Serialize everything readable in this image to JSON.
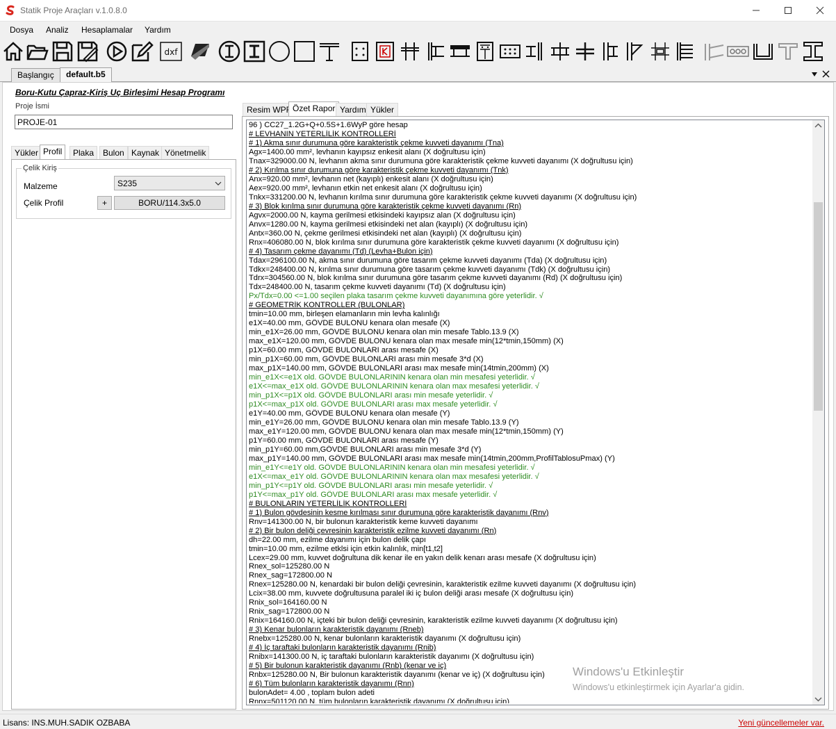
{
  "window": {
    "title": "Statik Proje Araçları v.1.0.8.0"
  },
  "menu": {
    "items": [
      "Dosya",
      "Analiz",
      "Hesaplamalar",
      "Yardım"
    ]
  },
  "toolbar": {
    "dxf_label": "dxf"
  },
  "doc_tabs": [
    "Başlangıç",
    "default.b5"
  ],
  "left": {
    "program_title": "Boru-Kutu Çapraz-Kiriş Uç Birleşimi Hesap Programı",
    "project_label": "Proje İsmi",
    "project_value": "PROJE-01",
    "tabs": [
      "Yükler",
      "Profil",
      "Plaka",
      "Bulon",
      "Kaynak",
      "Yönetmelik"
    ],
    "group_title": "Çelik Kiriş",
    "material_label": "Malzeme",
    "material_value": "S235",
    "profile_label": "Çelik Profil",
    "add_label": "+",
    "profile_value": "BORU/114.3x5.0"
  },
  "right": {
    "tabs": [
      "Resim WPF",
      "Özet Rapor",
      "Yardım",
      "Yükler"
    ]
  },
  "report_lines": [
    {
      "t": "96 )  CC27_1.2G+Q+0.5S+1.6WyP göre hesap",
      "k": "n"
    },
    {
      "t": "# LEVHANIN YETERLİLİK KONTROLLERİ",
      "k": "h"
    },
    {
      "t": "# 1) Akma sınır durumuna göre karakteristik çekme kuvveti dayanımı (Tna)",
      "k": "h"
    },
    {
      "t": "Agx=1400.00 mm², levhanın kayıpsız enkesit alanı (X doğrultusu için)",
      "k": "n"
    },
    {
      "t": "Tnax=329000.00 N, levhanın akma sınır durumuna göre karakteristik çekme kuvveti dayanımı (X doğrultusu için)",
      "k": "n"
    },
    {
      "t": "# 2) Kırılma sınır durumuna göre karakteristik çekme kuvveti dayanımı (Tnk)",
      "k": "h"
    },
    {
      "t": "Anx=920.00 mm², levhanın net (kayıplı) enkesit alanı (X doğrultusu için)",
      "k": "n"
    },
    {
      "t": "Aex=920.00 mm², levhanın etkin net enkesit alanı (X doğrultusu için)",
      "k": "n"
    },
    {
      "t": "Tnkx=331200.00 N, levhanın kırılma sınır durumuna göre karakteristik çekme kuvveti dayanımı (X doğrultusu için)",
      "k": "n"
    },
    {
      "t": "# 3) Blok kırılma sınır durumuna göre karakteristik çekme kuvveti dayanımı (Rn)",
      "k": "h"
    },
    {
      "t": "Agvx=2000.00 N, kayma gerilmesi etkisindeki kayıpsız alan (X doğrultusu için)",
      "k": "n"
    },
    {
      "t": "Anvx=1280.00 N, kayma gerilmesi etkisindeki net alan (kayıplı) (X doğrultusu için)",
      "k": "n"
    },
    {
      "t": "Antx=360.00 N, çekme gerilmesi etkisindeki net alan (kayıplı) (X doğrultusu için)",
      "k": "n"
    },
    {
      "t": "Rnx=406080.00 N, blok kırılma sınır durumuna göre karakteristik çekme kuvveti dayanımı (X doğrultusu için)",
      "k": "n"
    },
    {
      "t": "# 4) Tasarım çekme dayanımı (Td) (Levha+Bulon için)",
      "k": "h"
    },
    {
      "t": "Tdax=296100.00 N, akma sınır durumuna göre tasarım çekme kuvveti dayanımı (Tda) (X doğrultusu için)",
      "k": "n"
    },
    {
      "t": "Tdkx=248400.00 N, kırılma sınır durumuna göre tasarım çekme kuvveti dayanımı (Tdk) (X doğrultusu için)",
      "k": "n"
    },
    {
      "t": "Tdrx=304560.00 N, blok kırılma sınır durumuna göre tasarım çekme kuvveti dayanımı (Rd) (X doğrultusu için)",
      "k": "n"
    },
    {
      "t": "Tdx=248400.00 N, tasarım çekme kuvveti dayanımı (Td) (X doğrultusu için)",
      "k": "n"
    },
    {
      "t": "Px/Tdx=0.00 <=1.00 seçilen plaka tasarım çekme kuvveti dayanımına göre yeterlidir. √",
      "k": "ok"
    },
    {
      "t": "# GEOMETRİK KONTROLLER (BULONLAR)",
      "k": "h"
    },
    {
      "t": "tmin=10.00 mm, birleşen elamanların min levha kalınlığı",
      "k": "n"
    },
    {
      "t": "e1X=40.00 mm, GÖVDE BULONU kenara olan mesafe (X)",
      "k": "n"
    },
    {
      "t": "min_e1X=26.00 mm, GÖVDE BULONU kenara olan min mesafe Tablo.13.9 (X)",
      "k": "n"
    },
    {
      "t": "max_e1X=120.00 mm, GÖVDE BULONU kenara olan max mesafe min(12*tmin,150mm) (X)",
      "k": "n"
    },
    {
      "t": "p1X=60.00 mm, GÖVDE BULONLARI arası mesafe (X)",
      "k": "n"
    },
    {
      "t": "min_p1X=60.00 mm, GÖVDE BULONLARI arası min mesafe 3*d (X)",
      "k": "n"
    },
    {
      "t": "max_p1X=140.00 mm, GÖVDE BULONLARI arası max mesafe min(14tmin,200mm) (X)",
      "k": "n"
    },
    {
      "t": "min_e1X<=e1X old. GÖVDE BULONLARININ kenara olan min mesafesi yeterlidir. √",
      "k": "ok"
    },
    {
      "t": "e1X<=max_e1X old. GÖVDE BULONLARININ kenara olan max mesafesi yeterlidir. √",
      "k": "ok"
    },
    {
      "t": "min_p1X<=p1X old. GÖVDE BULONLARI arası min mesafe yeterlidir. √",
      "k": "ok"
    },
    {
      "t": "p1X<=max_p1X old. GÖVDE BULONLARI arası max mesafe yeterlidir. √",
      "k": "ok"
    },
    {
      "t": "e1Y=40.00 mm, GÖVDE BULONU kenara olan mesafe (Y)",
      "k": "n"
    },
    {
      "t": "min_e1Y=26.00 mm, GÖVDE BULONU kenara olan min mesafe Tablo.13.9 (Y)",
      "k": "n"
    },
    {
      "t": "max_e1Y=120.00 mm, GÖVDE BULONU kenara olan max mesafe min(12*tmin,150mm) (Y)",
      "k": "n"
    },
    {
      "t": "p1Y=60.00 mm, GÖVDE BULONLARI arası mesafe (Y)",
      "k": "n"
    },
    {
      "t": "min_p1Y=60.00 mm,GÖVDE BULONLARI arası min mesafe 3*d (Y)",
      "k": "n"
    },
    {
      "t": "max_p1Y=140.00 mm, GÖVDE BULONLARI arası max mesafe min(14tmin,200mm,ProfilTablosuPmax) (Y)",
      "k": "n"
    },
    {
      "t": "min_e1Y<=e1Y old. GÖVDE BULONLARININ kenara olan min mesafesi yeterlidir. √",
      "k": "ok"
    },
    {
      "t": "e1X<=max_e1Y old. GÖVDE BULONLARININ kenara olan max mesafesi yeterlidir. √",
      "k": "ok"
    },
    {
      "t": "min_p1Y<=p1Y old. GÖVDE BULONLARI arası min mesafe yeterlidir. √",
      "k": "ok"
    },
    {
      "t": "p1Y<=max_p1Y old. GÖVDE BULONLARI arası max mesafe yeterlidir. √",
      "k": "ok"
    },
    {
      "t": "# BULONLARIN YETERLİLİK KONTROLLERİ",
      "k": "h"
    },
    {
      "t": "# 1) Bulon gövdesinin kesme kırılması sınır durumuna göre karakteristik dayanımı (Rnv)",
      "k": "h"
    },
    {
      "t": "Rnv=141300.00 N, bir bulonun karakteristik keme kuvveti dayanımı",
      "k": "n"
    },
    {
      "t": "# 2) Bir bulon deliği çevresinin karakteristik ezilme kuvveti dayanımı (Rn)",
      "k": "h"
    },
    {
      "t": "dh=22.00 mm, ezilme dayanımı için bulon delik çapı",
      "k": "n"
    },
    {
      "t": "tmin=10.00 mm, ezilme etklsi için etkin kalınlık, min[t1,t2]",
      "k": "n"
    },
    {
      "t": "Lcex=29.00 mm, kuvvet doğrultuna dik kenar ile en yakın delik kenarı arası mesafe (X doğrultusu için)",
      "k": "n"
    },
    {
      "t": "Rnex_sol=125280.00 N",
      "k": "n"
    },
    {
      "t": "Rnex_sag=172800.00 N",
      "k": "n"
    },
    {
      "t": "Rnex=125280.00 N, kenardaki bir bulon deliği çevresinin, karakteristik ezilme kuvveti dayanımı (X doğrultusu için)",
      "k": "n"
    },
    {
      "t": "Lcix=38.00 mm, kuvvete doğrultusuna paralel iki iç bulon deliği arası mesafe (X doğrultusu için)",
      "k": "n"
    },
    {
      "t": "Rnix_sol=164160.00 N",
      "k": "n"
    },
    {
      "t": "Rnix_sag=172800.00 N",
      "k": "n"
    },
    {
      "t": "Rnix=164160.00 N, içteki bir bulon deliği çevresinin, karakteristik ezilme kuvveti dayanımı (X doğrultusu için)",
      "k": "n"
    },
    {
      "t": "# 3) Kenar bulonların karakteristik dayanımı (Rneb)",
      "k": "h"
    },
    {
      "t": "Rnebx=125280.00 N, kenar bulonların karakteristik dayanımı (X doğrultusu için)",
      "k": "n"
    },
    {
      "t": "# 4) İç taraftaki bulonların karakteristik dayanımı (Rnib)",
      "k": "h"
    },
    {
      "t": "Rnibx=141300.00 N, iç taraftaki bulonların karakteristik dayanımı (X doğrultusu için)",
      "k": "n"
    },
    {
      "t": "# 5) Bir bulonun karakteristik dayanımı (Rnb) (kenar ve iç)",
      "k": "h"
    },
    {
      "t": "Rnbx=125280.00 N, Bir bulonun karakteristik dayanımı (kenar ve iç) (X doğrultusu için)",
      "k": "n"
    },
    {
      "t": "# 6) Tüm bulonların karakteristik dayanımı (Rnn)",
      "k": "h"
    },
    {
      "t": "bulonAdet= 4.00 , toplam bulon adeti",
      "k": "n"
    },
    {
      "t": "Rnnx=501120.00 N, tüm bulonların karakteristik dayanımı (X doğrultusu için)",
      "k": "n"
    }
  ],
  "watermark": {
    "title": "Windows'u Etkinleştir",
    "subtitle": "Windows'u etkinleştirmek için Ayarlar'a gidin."
  },
  "status": {
    "license": "Lisans: INS.MUH.SADIK OZBABA",
    "update": "Yeni güncellemeler var."
  },
  "colors": {
    "ok_text": "#2e8b22",
    "update_link": "#cc0000",
    "logo_red": "#d9261c"
  }
}
